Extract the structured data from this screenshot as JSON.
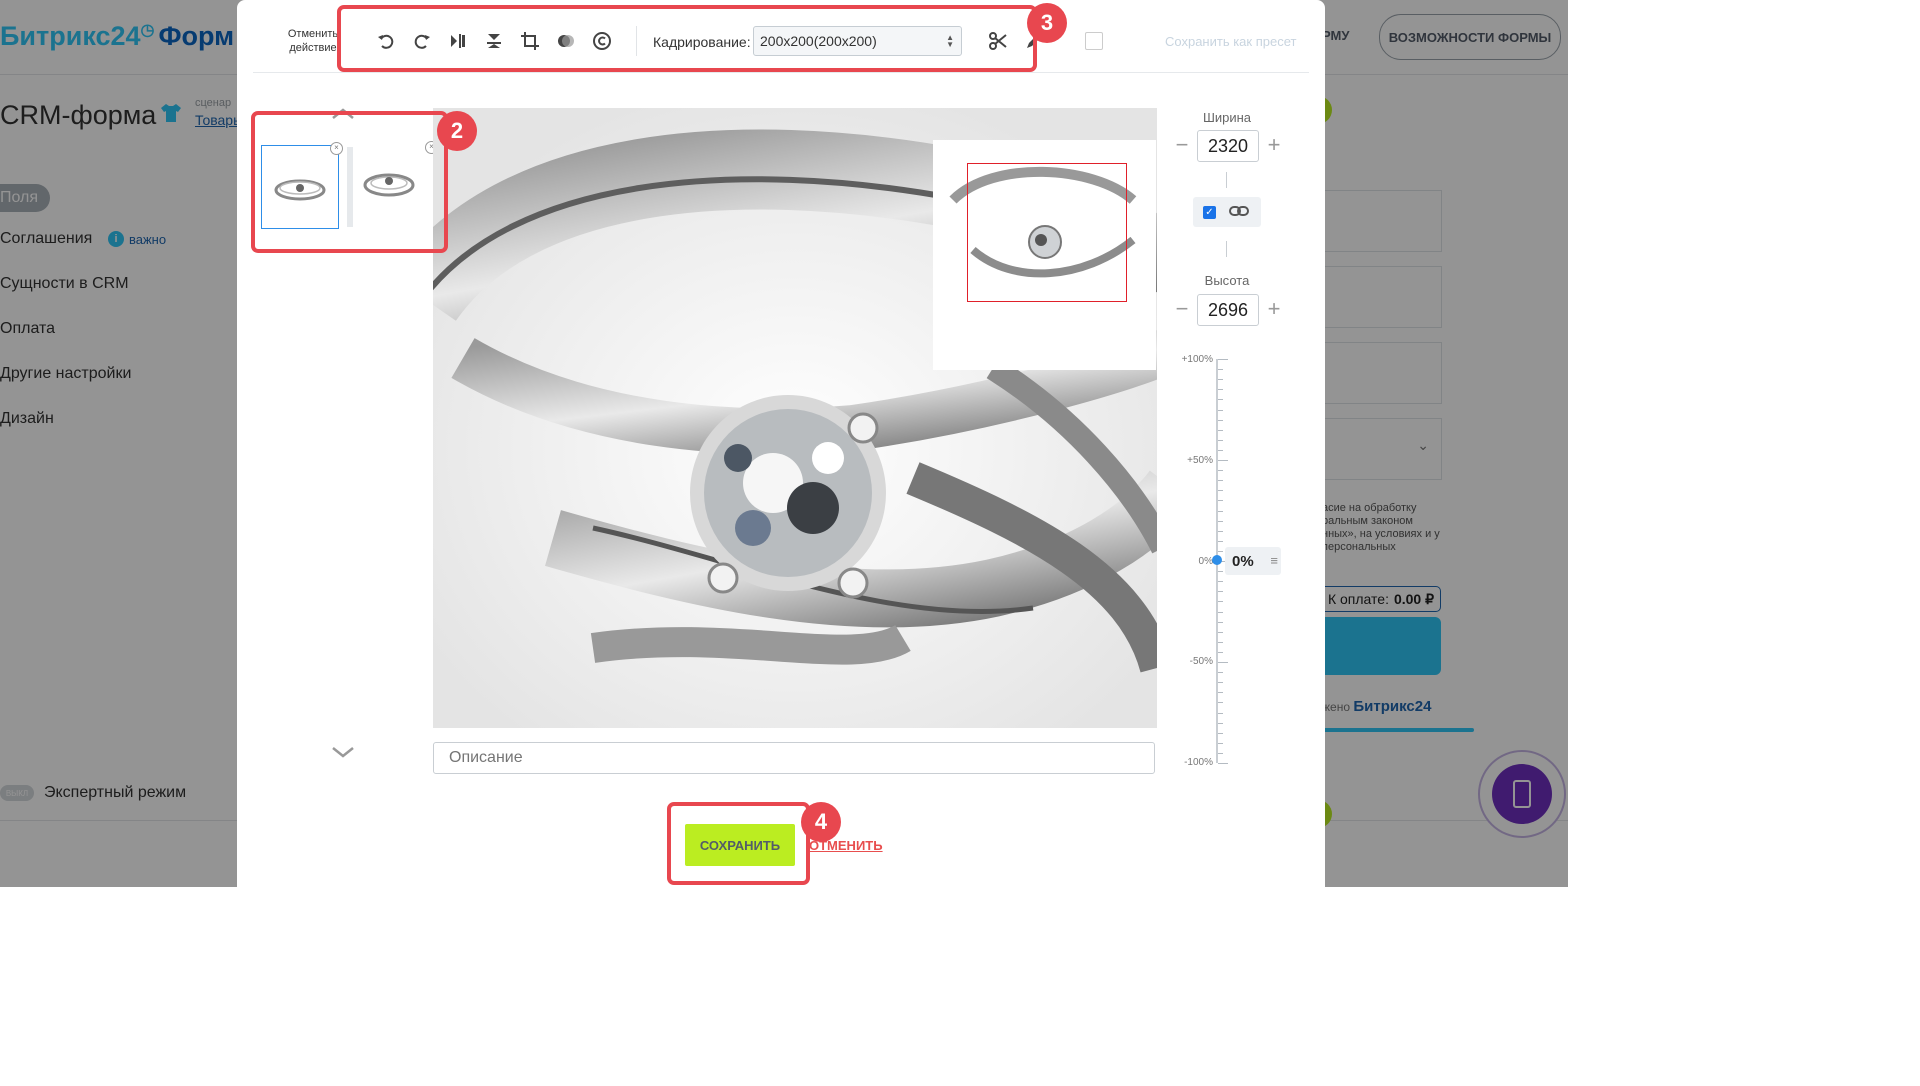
{
  "background": {
    "logo": {
      "brand": "Битрикс24",
      "product": "Форм"
    },
    "header_buttons": {
      "form_partial": "РМУ",
      "features": "ВОЗМОЖНОСТИ ФОРМЫ"
    },
    "page_title": "CRM-форма",
    "scenario": {
      "label": "сценар",
      "value": "Товары"
    },
    "nav": [
      "Поля",
      "Соглашения",
      "Сущности в CRM",
      "Оплата",
      "Другие настройки",
      "Дизайн"
    ],
    "important_label": "важно",
    "expert": {
      "toggle": "ВЫКЛ",
      "label": "Экспертный режим"
    },
    "preview": {
      "legal_text": "асие на обработку ральным законом нных», на условиях и у персональных",
      "pay_label": "К оплате:",
      "pay_value": "0.00 ₽",
      "powered_prefix": "жено",
      "powered_brand": "Битрикс24"
    }
  },
  "editor": {
    "toolbar": {
      "undo_label": "Отменить действие",
      "tools": [
        "rotate-left-icon",
        "rotate-right-icon",
        "flip-horizontal-icon",
        "flip-vertical-icon",
        "crop-icon",
        "filter-icon",
        "copyright-icon"
      ],
      "crop_label": "Кадрирование:",
      "crop_value": "200x200(200x200)",
      "save_preset": "Сохранить как пресет"
    },
    "width_label": "Ширина",
    "width_value": "2320",
    "height_label": "Высота",
    "height_value": "2696",
    "keep_ratio": true,
    "zoom": {
      "ticks": [
        "+100%",
        "+50%",
        "0%",
        "-50%",
        "-100%"
      ],
      "value": "0%"
    },
    "description_placeholder": "Описание",
    "save_button": "СОХРАНИТЬ",
    "cancel_button": "ОТМЕНИТЬ",
    "thumbnails": [
      "ring-photo-1",
      "ring-photo-2"
    ]
  },
  "callouts": [
    "2",
    "3",
    "4"
  ],
  "colors": {
    "accent_blue": "#2fc6f6",
    "save_green": "#bbed21",
    "callout_red": "#e8474f",
    "selection_blue": "#2e8ee8"
  }
}
